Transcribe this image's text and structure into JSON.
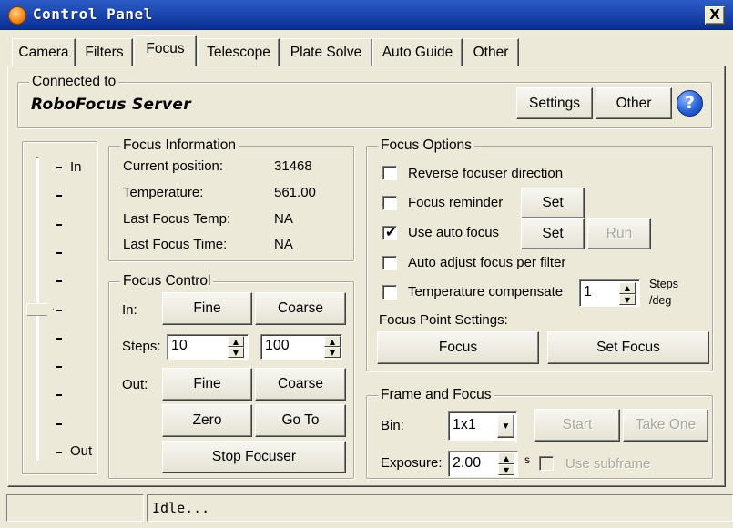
{
  "window": {
    "title": "Control Panel",
    "close_label": "X"
  },
  "tabs": [
    {
      "label": "Camera"
    },
    {
      "label": "Filters"
    },
    {
      "label": "Focus",
      "active": true
    },
    {
      "label": "Telescope"
    },
    {
      "label": "Plate Solve"
    },
    {
      "label": "Auto Guide"
    },
    {
      "label": "Other"
    }
  ],
  "connection": {
    "legend": "Connected to",
    "server": "RoboFocus Server",
    "settings_label": "Settings",
    "other_label": "Other",
    "help_glyph": "?"
  },
  "slider": {
    "top_label": "In",
    "bottom_label": "Out",
    "position": 0.5
  },
  "focus_info": {
    "legend": "Focus Information",
    "rows": [
      {
        "label": "Current position:",
        "value": "31468"
      },
      {
        "label": "Temperature:",
        "value": "561.00"
      },
      {
        "label": "Last Focus Temp:",
        "value": "NA"
      },
      {
        "label": "Last Focus Time:",
        "value": "NA"
      }
    ]
  },
  "focus_control": {
    "legend": "Focus Control",
    "in_label": "In:",
    "out_label": "Out:",
    "steps_label": "Steps:",
    "fine_steps": "10",
    "coarse_steps": "100",
    "fine_label": "Fine",
    "coarse_label": "Coarse",
    "zero_label": "Zero",
    "goto_label": "Go To",
    "stop_label": "Stop Focuser"
  },
  "focus_options": {
    "legend": "Focus Options",
    "reverse_label": "Reverse focuser direction",
    "reverse_checked": false,
    "reminder_label": "Focus reminder",
    "reminder_checked": false,
    "auto_label": "Use auto focus",
    "auto_checked": true,
    "adjust_label": "Auto adjust focus per filter",
    "adjust_checked": false,
    "temp_label": "Temperature compensate",
    "temp_checked": false,
    "temp_value": "1",
    "steps_unit_1": "Steps",
    "steps_unit_2": "/deg",
    "set_label": "Set",
    "run_label": "Run",
    "point_settings_label": "Focus Point Settings:",
    "focus_label": "Focus",
    "set_focus_label": "Set Focus"
  },
  "frame_focus": {
    "legend": "Frame and Focus",
    "bin_label": "Bin:",
    "bin_value": "1x1",
    "start_label": "Start",
    "take_one_label": "Take One",
    "exposure_label": "Exposure:",
    "exposure_value": "2.00",
    "exposure_unit": "s",
    "subframe_label": "Use subframe",
    "subframe_checked": false
  },
  "status": {
    "text": "Idle..."
  }
}
